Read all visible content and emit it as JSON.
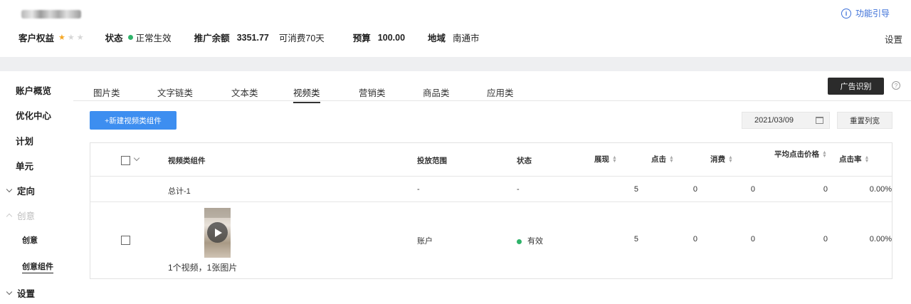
{
  "header": {
    "guide_label": "功能引导",
    "settings_label": "设置",
    "customer_rights_label": "客户权益",
    "stars_filled": 1,
    "stars_total": 3,
    "status_label": "状态",
    "status_value": "正常生效",
    "balance_label": "推广余额",
    "balance_value": "3351.77",
    "balance_note": "可消费70天",
    "budget_label": "预算",
    "budget_value": "100.00",
    "region_label": "地域",
    "region_value": "南通市"
  },
  "sidebar": {
    "items": [
      {
        "label": "账户概览"
      },
      {
        "label": "优化中心"
      },
      {
        "label": "计划"
      },
      {
        "label": "单元"
      },
      {
        "label": "定向"
      },
      {
        "label": "创意"
      },
      {
        "label": "创意"
      },
      {
        "label": "创意组件"
      },
      {
        "label": "设置"
      }
    ]
  },
  "tabs": [
    "图片类",
    "文字链类",
    "文本类",
    "视频类",
    "营销类",
    "商品类",
    "应用类"
  ],
  "active_tab": "视频类",
  "toolbar": {
    "ad_recognition": "广告识别",
    "new_component": "+新建视频类组件",
    "date": "2021/03/09",
    "reset_columns": "重置列宽"
  },
  "table": {
    "columns": [
      "视频类组件",
      "投放范围",
      "状态",
      "展现",
      "点击",
      "消费",
      "平均点击价格",
      "点击率"
    ],
    "total_row": {
      "name": "总计-1",
      "scope": "-",
      "status": "-",
      "impressions": "5",
      "clicks": "0",
      "cost": "0",
      "avg_cpc": "0",
      "ctr": "0.00%"
    },
    "rows": [
      {
        "caption": "1个视频，1张图片",
        "scope": "账户",
        "status": "有效",
        "impressions": "5",
        "clicks": "0",
        "cost": "0",
        "avg_cpc": "0",
        "ctr": "0.00%"
      }
    ]
  },
  "colors": {
    "accent_blue": "#3d8ef0",
    "link_blue": "#3b6fd8",
    "status_green": "#2fb36a",
    "star_gold": "#f5a623",
    "dark_button": "#2b2b2b"
  },
  "icons": [
    "info-icon",
    "star-icon",
    "chevron-down-icon",
    "chevron-up-icon",
    "help-icon",
    "calendar-icon",
    "sort-icon",
    "play-icon"
  ]
}
